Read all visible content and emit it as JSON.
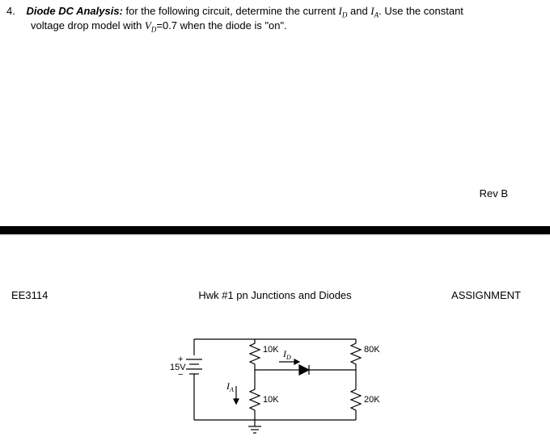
{
  "question": {
    "number": "4.",
    "title": "Diode DC Analysis:",
    "body_part1": " for the following circuit, determine the current ",
    "var1": "I",
    "var1_sub": "D",
    "body_and": " and ",
    "var2": "I",
    "var2_sub": "A",
    "body_part2": ". Use the constant",
    "line2_a": "voltage drop model with ",
    "vd": "V",
    "vd_sub": "D",
    "line2_b": "=0.7 when the diode is \"on\"."
  },
  "rev": "Rev B",
  "header": {
    "left": "EE3114",
    "center": "Hwk #1 pn Junctions and Diodes",
    "right": "ASSIGNMENT"
  },
  "circuit": {
    "vsrc_plus": "+",
    "vsrc_minus": "−",
    "vsrc": "15V",
    "r1": "10K",
    "r2": "10K",
    "r3": "80K",
    "r4": "20K",
    "id": "I",
    "id_sub": "D",
    "ia": "I",
    "ia_sub": "A"
  }
}
